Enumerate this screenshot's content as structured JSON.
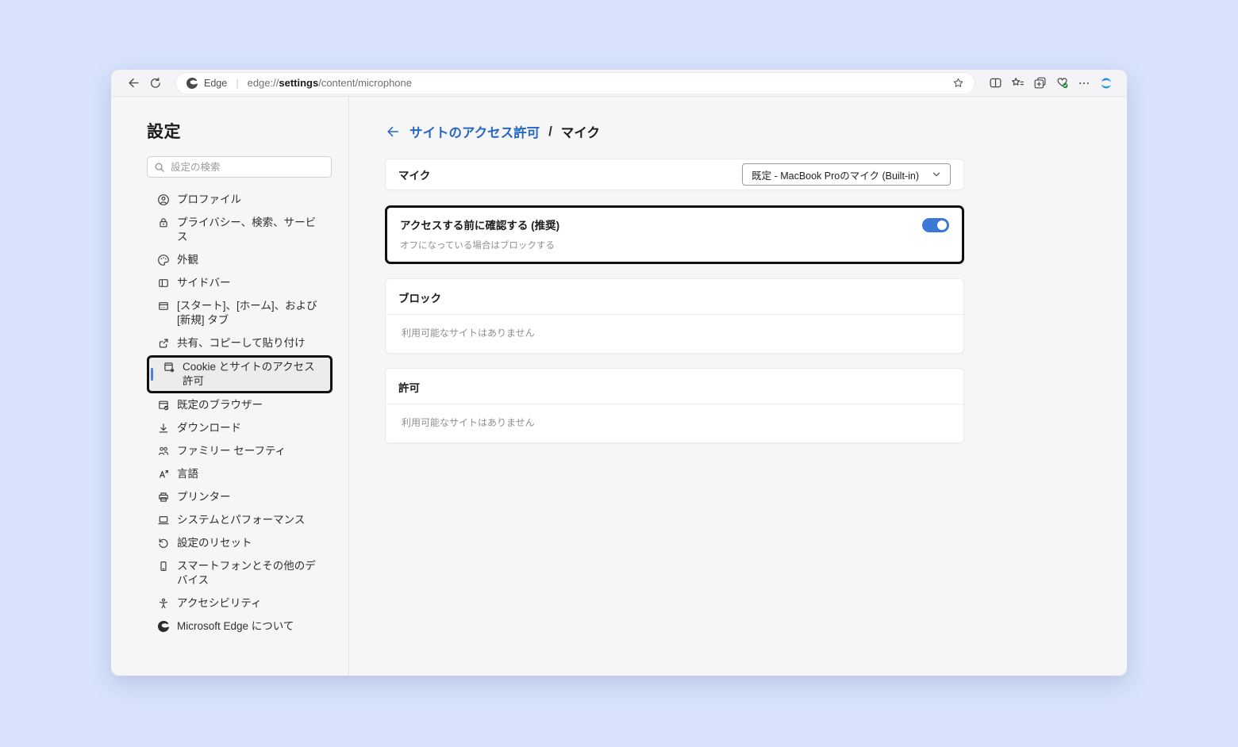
{
  "colors": {
    "desktop_background": "#d8e3fb",
    "accent_blue": "#3c78d8",
    "link_blue": "#2767c5",
    "selected_indicator": "#4f7fd9",
    "annotation_border": "#101010"
  },
  "browser": {
    "site_label": "Edge",
    "url_scheme": "edge://",
    "url_bold": "settings",
    "url_rest": "/content/microphone",
    "toolbar_icons": [
      "back-icon",
      "reload-icon",
      "favorite-star-icon",
      "split-screen-icon",
      "favorites-icon",
      "collections-icon",
      "browser-essentials-icon",
      "more-menu-icon",
      "copilot-icon"
    ]
  },
  "sidebar": {
    "title": "設定",
    "search_placeholder": "設定の検索",
    "items": [
      {
        "label": "プロファイル",
        "icon": "profile-icon",
        "selected": false
      },
      {
        "label": "プライバシー、検索、サービス",
        "icon": "privacy-lock-icon",
        "selected": false
      },
      {
        "label": "外観",
        "icon": "appearance-palette-icon",
        "selected": false
      },
      {
        "label": "サイドバー",
        "icon": "sidebar-panel-icon",
        "selected": false
      },
      {
        "label": "[スタート]、[ホーム]、および [新規] タブ",
        "icon": "start-home-tabs-icon",
        "selected": false
      },
      {
        "label": "共有、コピーして貼り付け",
        "icon": "share-copy-paste-icon",
        "selected": false
      },
      {
        "label": "Cookie とサイトのアクセス許可",
        "icon": "cookies-permissions-icon",
        "selected": true
      },
      {
        "label": "既定のブラウザー",
        "icon": "default-browser-icon",
        "selected": false
      },
      {
        "label": "ダウンロード",
        "icon": "downloads-icon",
        "selected": false
      },
      {
        "label": "ファミリー セーフティ",
        "icon": "family-safety-icon",
        "selected": false
      },
      {
        "label": "言語",
        "icon": "languages-icon",
        "selected": false
      },
      {
        "label": "プリンター",
        "icon": "printer-icon",
        "selected": false
      },
      {
        "label": "システムとパフォーマンス",
        "icon": "system-performance-icon",
        "selected": false
      },
      {
        "label": "設定のリセット",
        "icon": "reset-settings-icon",
        "selected": false
      },
      {
        "label": "スマートフォンとその他のデバイス",
        "icon": "phone-devices-icon",
        "selected": false
      },
      {
        "label": "アクセシビリティ",
        "icon": "accessibility-icon",
        "selected": false
      },
      {
        "label": "Microsoft Edge について",
        "icon": "edge-logo-icon",
        "selected": false
      }
    ]
  },
  "main": {
    "breadcrumb_link": "サイトのアクセス許可",
    "breadcrumb_sep": "/",
    "page_title": "マイク",
    "mic_row": {
      "label": "マイク",
      "dropdown_value": "既定 - MacBook Proのマイク (Built-in)"
    },
    "ask_card": {
      "title": "アクセスする前に確認する (推奨)",
      "subtitle": "オフになっている場合はブロックする",
      "toggle_state": "on"
    },
    "block_section": {
      "title": "ブロック",
      "empty_text": "利用可能なサイトはありません"
    },
    "allow_section": {
      "title": "許可",
      "empty_text": "利用可能なサイトはありません"
    }
  }
}
